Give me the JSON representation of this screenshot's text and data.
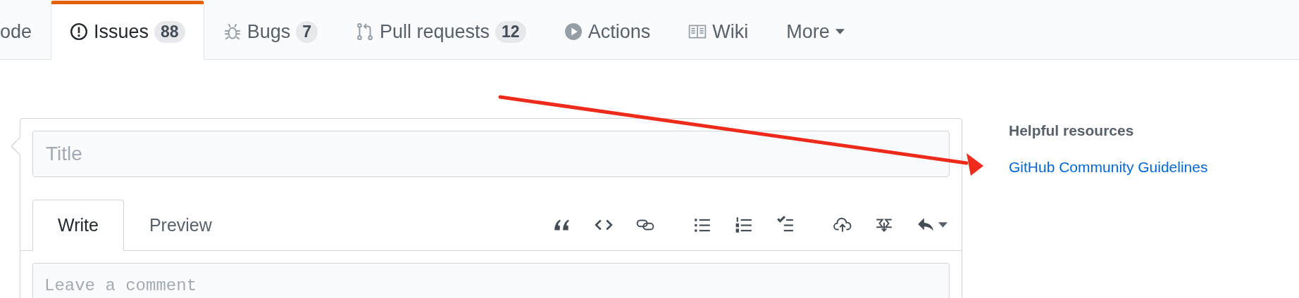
{
  "tabs": [
    {
      "label": "ode",
      "selected": false
    },
    {
      "label": "Issues",
      "count": "88",
      "selected": true
    },
    {
      "label": "Bugs",
      "count": "7",
      "selected": false
    },
    {
      "label": "Pull requests",
      "count": "12",
      "selected": false
    },
    {
      "label": "Actions",
      "selected": false
    },
    {
      "label": "Wiki",
      "selected": false
    },
    {
      "label": "More",
      "selected": false
    }
  ],
  "issue_form": {
    "title_field": {
      "placeholder": "Title"
    },
    "editor_tabs": [
      {
        "label": "Write",
        "selected": true
      },
      {
        "label": "Preview",
        "selected": false
      }
    ],
    "comment_field": {
      "placeholder": "Leave a comment"
    }
  },
  "sidebar": {
    "heading": "Helpful resources",
    "links": [
      "GitHub Community Guidelines"
    ]
  }
}
